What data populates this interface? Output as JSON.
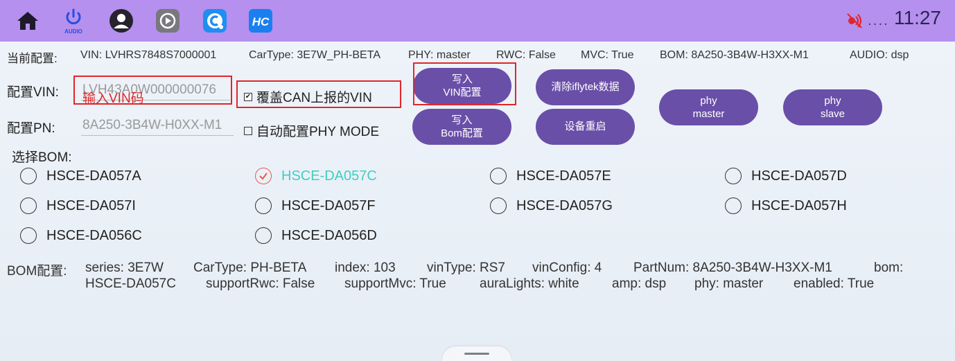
{
  "status": {
    "time": "11:27",
    "dots": "....",
    "signal_icon": "signal-off-icon"
  },
  "apps": [
    {
      "name": "home-icon"
    },
    {
      "name": "audio-power-icon",
      "label": "AUDIO"
    },
    {
      "name": "profile-icon"
    },
    {
      "name": "play-app-icon"
    },
    {
      "name": "c-app-icon"
    },
    {
      "name": "hc-app-icon"
    }
  ],
  "current": {
    "label": "当前配置:",
    "vin": "VIN: LVHRS7848S7000001",
    "cartype": "CarType: 3E7W_PH-BETA",
    "phy": "PHY: master",
    "rwc": "RWC: False",
    "mvc": "MVC: True",
    "bom": "BOM: 8A250-3B4W-H3XX-M1",
    "audio": "AUDIO: dsp"
  },
  "vin": {
    "label": "配置VIN:",
    "value": "LVH43A0W000000076",
    "hint": "输入VIN码"
  },
  "pn": {
    "label": "配置PN:",
    "value": "8A250-3B4W-H0XX-M1"
  },
  "checks": {
    "cover_vin": {
      "label": "覆盖CAN上报的VIN",
      "checked": true
    },
    "auto_phy": {
      "label": "自动配置PHY MODE",
      "checked": false
    }
  },
  "buttons": {
    "write_vin_l1": "写入",
    "write_vin_l2": "VIN配置",
    "write_bom_l1": "写入",
    "write_bom_l2": "Bom配置",
    "clear_iflytek": "清除iflytek数据",
    "reboot": "设备重启",
    "phy_master_l1": "phy",
    "phy_master_l2": "master",
    "phy_slave_l1": "phy",
    "phy_slave_l2": "slave"
  },
  "select_bom_label": "选择BOM:",
  "bom_options": [
    "HSCE-DA057A",
    "HSCE-DA057C",
    "HSCE-DA057E",
    "HSCE-DA057D",
    "HSCE-DA057I",
    "HSCE-DA057F",
    "HSCE-DA057G",
    "HSCE-DA057H",
    "HSCE-DA056C",
    "HSCE-DA056D"
  ],
  "bom_selected": "HSCE-DA057C",
  "bom_config": {
    "label": "BOM配置:",
    "series": "series: 3E7W",
    "cartype": "CarType: PH-BETA",
    "index": "index: 103",
    "vintype": "vinType: RS7",
    "vinconfig": "vinConfig: 4",
    "partnum": "PartNum: 8A250-3B4W-H3XX-M1",
    "bom_key": "bom:",
    "bom_val": "HSCE-DA057C",
    "support_rwc": "supportRwc: False",
    "support_mvc": "supportMvc: True",
    "aura": "auraLights: white",
    "amp": "amp: dsp",
    "phy": "phy: master",
    "enabled": "enabled: True"
  },
  "colors": {
    "topbar": "#b590ee",
    "button": "#6a4fa8",
    "highlight": "#e0262a",
    "selected": "#3fcfc0"
  }
}
